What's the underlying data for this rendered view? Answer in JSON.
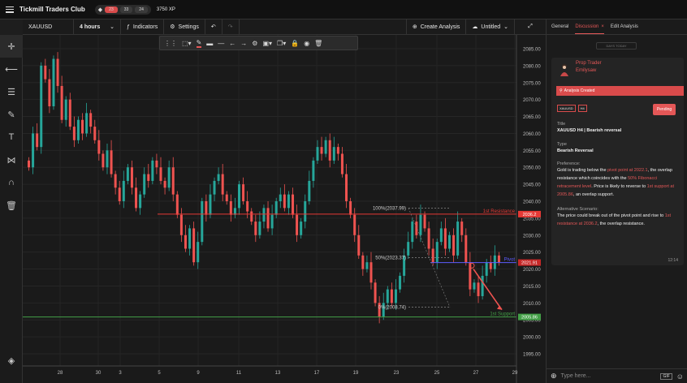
{
  "app": {
    "title": "Tickmill Traders Club",
    "rank": [
      "23",
      "33",
      "24"
    ],
    "xp": "3750 XP"
  },
  "chart_toolbar": {
    "symbol": "XAUUSD",
    "timeframe": "4 hours",
    "indicators": "Indicators",
    "settings": "Settings",
    "create_analysis": "Create Analysis",
    "untitled": "Untitled"
  },
  "left_tools": [
    "crosshair-icon",
    "horizontal-line-icon",
    "channel-icon",
    "brush-icon",
    "text-icon",
    "pattern-icon",
    "magnet-icon",
    "trash-icon"
  ],
  "price_axis": {
    "ticks": [
      "2085.00",
      "2080.00",
      "2075.00",
      "2070.00",
      "2065.00",
      "2060.00",
      "2055.00",
      "2050.00",
      "2045.00",
      "2040.00",
      "2035.00",
      "2030.00",
      "2025.00",
      "2020.00",
      "2015.00",
      "2010.00",
      "2005.00",
      "2000.00",
      "1995.00"
    ],
    "markers": {
      "resistance": "2036.2",
      "pivot": "2021.91",
      "support": "2005.86"
    }
  },
  "time_axis": [
    "28",
    "30",
    "3",
    "5",
    "9",
    "11",
    "13",
    "17",
    "19",
    "23",
    "25",
    "27",
    "29"
  ],
  "chart": {
    "levels": {
      "resistance_label": "1st Resistance",
      "pivot_label": "Pivot",
      "support_label": "1st Support"
    },
    "fib": {
      "top": "100%(2037.99)",
      "mid": "50%(2023.37)",
      "bottom": "0%(2008.74)"
    },
    "colors": {
      "up": "#26a69a",
      "down": "#ef5350",
      "resistance": "#e53935",
      "pivot": "#5c5cff",
      "support": "#43a047"
    }
  },
  "panel": {
    "tabs": {
      "general": "General",
      "discussion": "Discussion",
      "edit": "Edit Analysis"
    },
    "days_today": "DAYS TODAY",
    "author_role": "Prop Trader",
    "author_name": "Emilysaw",
    "status": "Analysis Created",
    "tags": [
      "XAUUSD",
      "H4"
    ],
    "pending": "Pending",
    "title_label": "Title",
    "title_value": "XAUUSD H4 | Bearish reversal",
    "type_label": "Type",
    "type_value": "Bearish Reversal",
    "preference_label": "Preference:",
    "preference": [
      {
        "t": "Gold is trading below the ",
        "h": false
      },
      {
        "t": "pivot point at 2022.1",
        "h": true
      },
      {
        "t": ", the overlap resistance which coincides with the ",
        "h": false
      },
      {
        "t": "50% Fibonacci retracement level",
        "h": true
      },
      {
        "t": ". Price is likely to reverse to ",
        "h": false
      },
      {
        "t": "1st support at 2005.86",
        "h": true
      },
      {
        "t": ", an overlap support.",
        "h": false
      }
    ],
    "alternative_label": "Alternative Scenario:",
    "alternative": [
      {
        "t": "The price could break out of the pivot point and rise to ",
        "h": false
      },
      {
        "t": "1st resistance at 2036.2",
        "h": true
      },
      {
        "t": ", the overlap resistance.",
        "h": false
      }
    ],
    "time": "12:14",
    "composer_placeholder": "Type here...",
    "gif": "GIF"
  }
}
